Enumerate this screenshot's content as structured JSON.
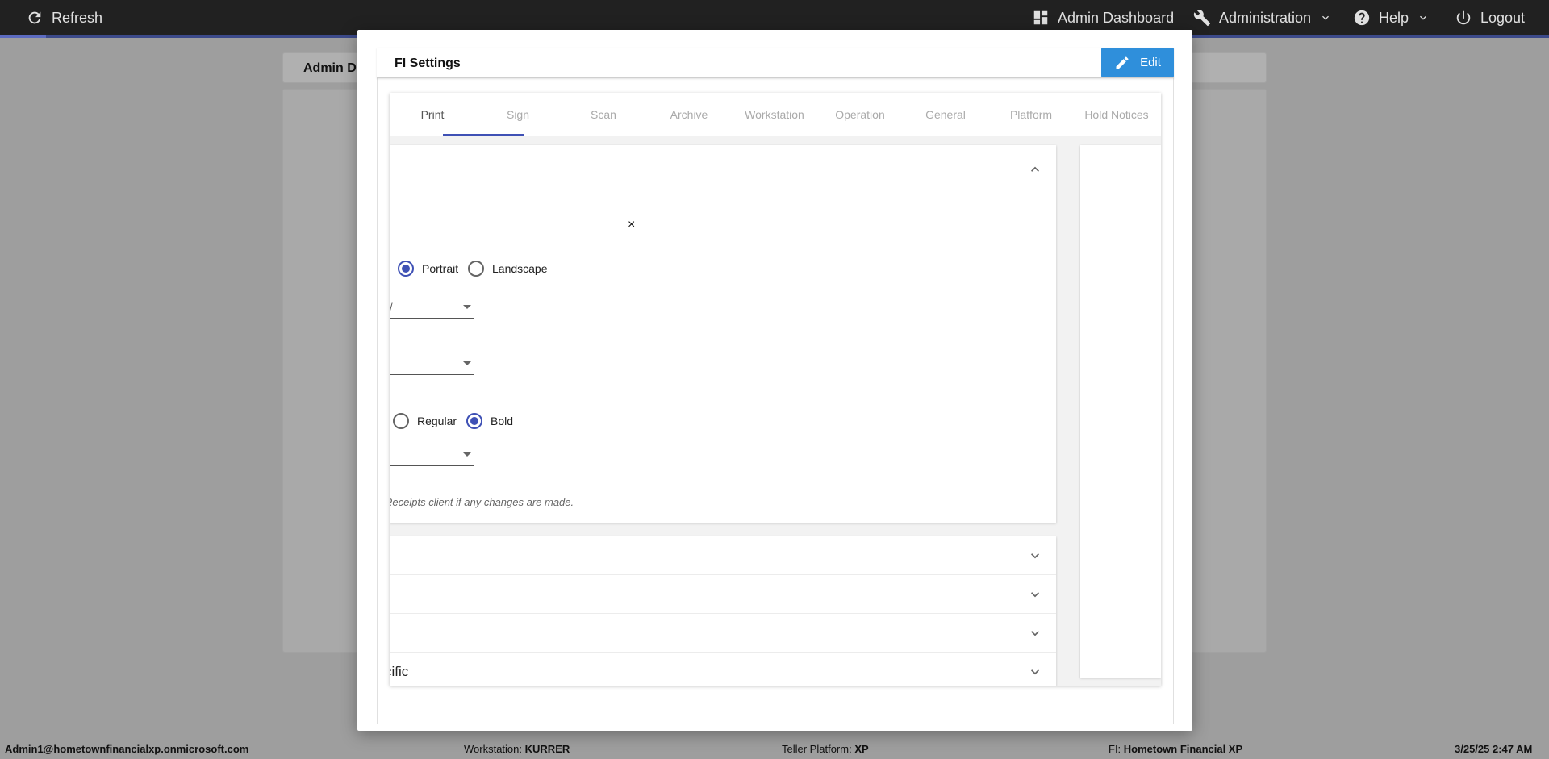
{
  "topbar": {
    "refresh_label": "Refresh",
    "admin_dashboard_label": "Admin Dashboard",
    "administration_label": "Administration",
    "help_label": "Help",
    "logout_label": "Logout"
  },
  "background": {
    "header_title": "Admin D"
  },
  "modal": {
    "title": "FI Settings",
    "edit_label": "Edit",
    "tabs": [
      {
        "label": "Print"
      },
      {
        "label": "Sign"
      },
      {
        "label": "Scan"
      },
      {
        "label": "Archive"
      },
      {
        "label": "Workstation"
      },
      {
        "label": "Operation"
      },
      {
        "label": "General"
      },
      {
        "label": "Platform"
      },
      {
        "label": "Hold Notices"
      }
    ],
    "active_tab": "Print",
    "clear_symbol": "×",
    "orientation": {
      "options": [
        "Portrait",
        "Landscape"
      ],
      "selected": "Portrait"
    },
    "select_one_partial": "/",
    "font_weight": {
      "options": [
        "Regular",
        "Bold"
      ],
      "selected": "Bold"
    },
    "note": "Receipts client if any changes are made.",
    "collapsed_sections": [
      "",
      "",
      "",
      "cific"
    ]
  },
  "statusbar": {
    "user": "Admin1@hometownfinancialxp.onmicrosoft.com",
    "workstation_label": "Workstation:",
    "workstation_value": "KURRER",
    "platform_label": "Teller Platform:",
    "platform_value": "XP",
    "fi_label": "FI:",
    "fi_value": "Hometown Financial XP",
    "datetime": "3/25/25 2:47 AM"
  },
  "colors": {
    "accent": "#3f51b5",
    "edit_button": "#2f8fdb",
    "topbar": "#212121"
  },
  "icons": [
    "refresh-icon",
    "dashboard-icon",
    "wrench-icon",
    "help-icon",
    "power-icon",
    "pencil-icon",
    "chevron-up-icon",
    "chevron-down-icon"
  ]
}
